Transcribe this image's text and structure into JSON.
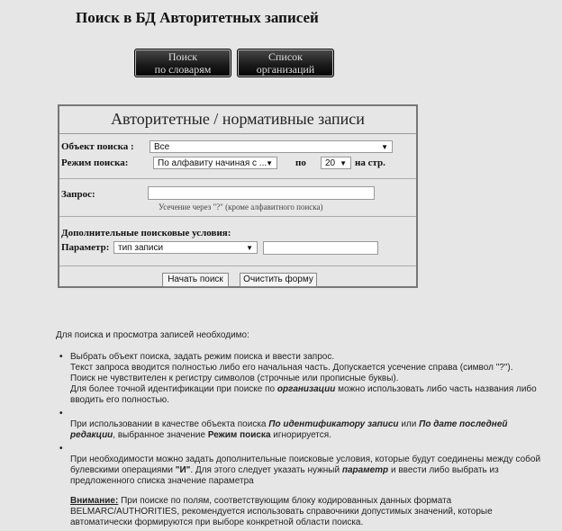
{
  "page": {
    "title": "Поиск в БД Авторитетных записей"
  },
  "nav": [
    {
      "line1": "Поиск",
      "line2": "по словарям"
    },
    {
      "line1": "Список",
      "line2": "организаций"
    }
  ],
  "form": {
    "title": "Авторитетные / нормативные записи",
    "object_label": "Объект поиска :",
    "object_value": "Все",
    "mode_label": "Режим поиска:",
    "mode_value": "По алфавиту начиная с ...",
    "per_label": "по",
    "per_value": "20",
    "per_suffix": "на стр.",
    "query_label": "Запрос:",
    "query_value": "",
    "query_hint": "Усечение через \"?\" (кроме алфавитного поиска)",
    "extra_title": "Дополнительные поисковые условия:",
    "param_label": "Параметр:",
    "param_value": "тип записи",
    "param_input": "",
    "search_btn": "Начать поиск",
    "clear_btn": "Очистить форму"
  },
  "info": {
    "intro": "Для поиска и просмотра записей необходимо:",
    "b1_l1": "Выбрать объект поиска, задать режим поиска и ввести запрос.",
    "b1_l2": "Текст запроса вводится полностью либо его начальная часть. Допускается усечение справа (символ \"?\").",
    "b1_l3": "Поиск не чувствителен к регистру символов (строчные или прописные буквы).",
    "b1_l4a": "Для более точной идентификации при поиске по ",
    "b1_l4b": "организации",
    "b1_l4c": " можно использовать либо часть названия либо вводить его полностью.",
    "b2_a": "При использовании в качестве объекта поиска ",
    "b2_b": "По идентификатору записи",
    "b2_c": " или ",
    "b2_d": "По дате последней редакции",
    "b2_e": ", выбранное значение ",
    "b2_f": "Режим поиска",
    "b2_g": " игнорируется.",
    "b3_a": "При необходимости можно задать дополнительные поисковые условия, которые будут соединены между собой булевскими операциями ",
    "b3_b": "\"И\"",
    "b3_c": ". Для этого следует указать нужный ",
    "b3_d": "параметр",
    "b3_e": " и ввести либо выбрать из предложенного списка значение параметра",
    "note_label": "Внимание:",
    "note_text": " При поиске по полям, соответствующим блоку кодированных данных формата BELMARC/AUTHORITIES, рекомендуется использовать справочники допустимых значений, которые автоматически формируются при выборе конкретной области поиска."
  }
}
